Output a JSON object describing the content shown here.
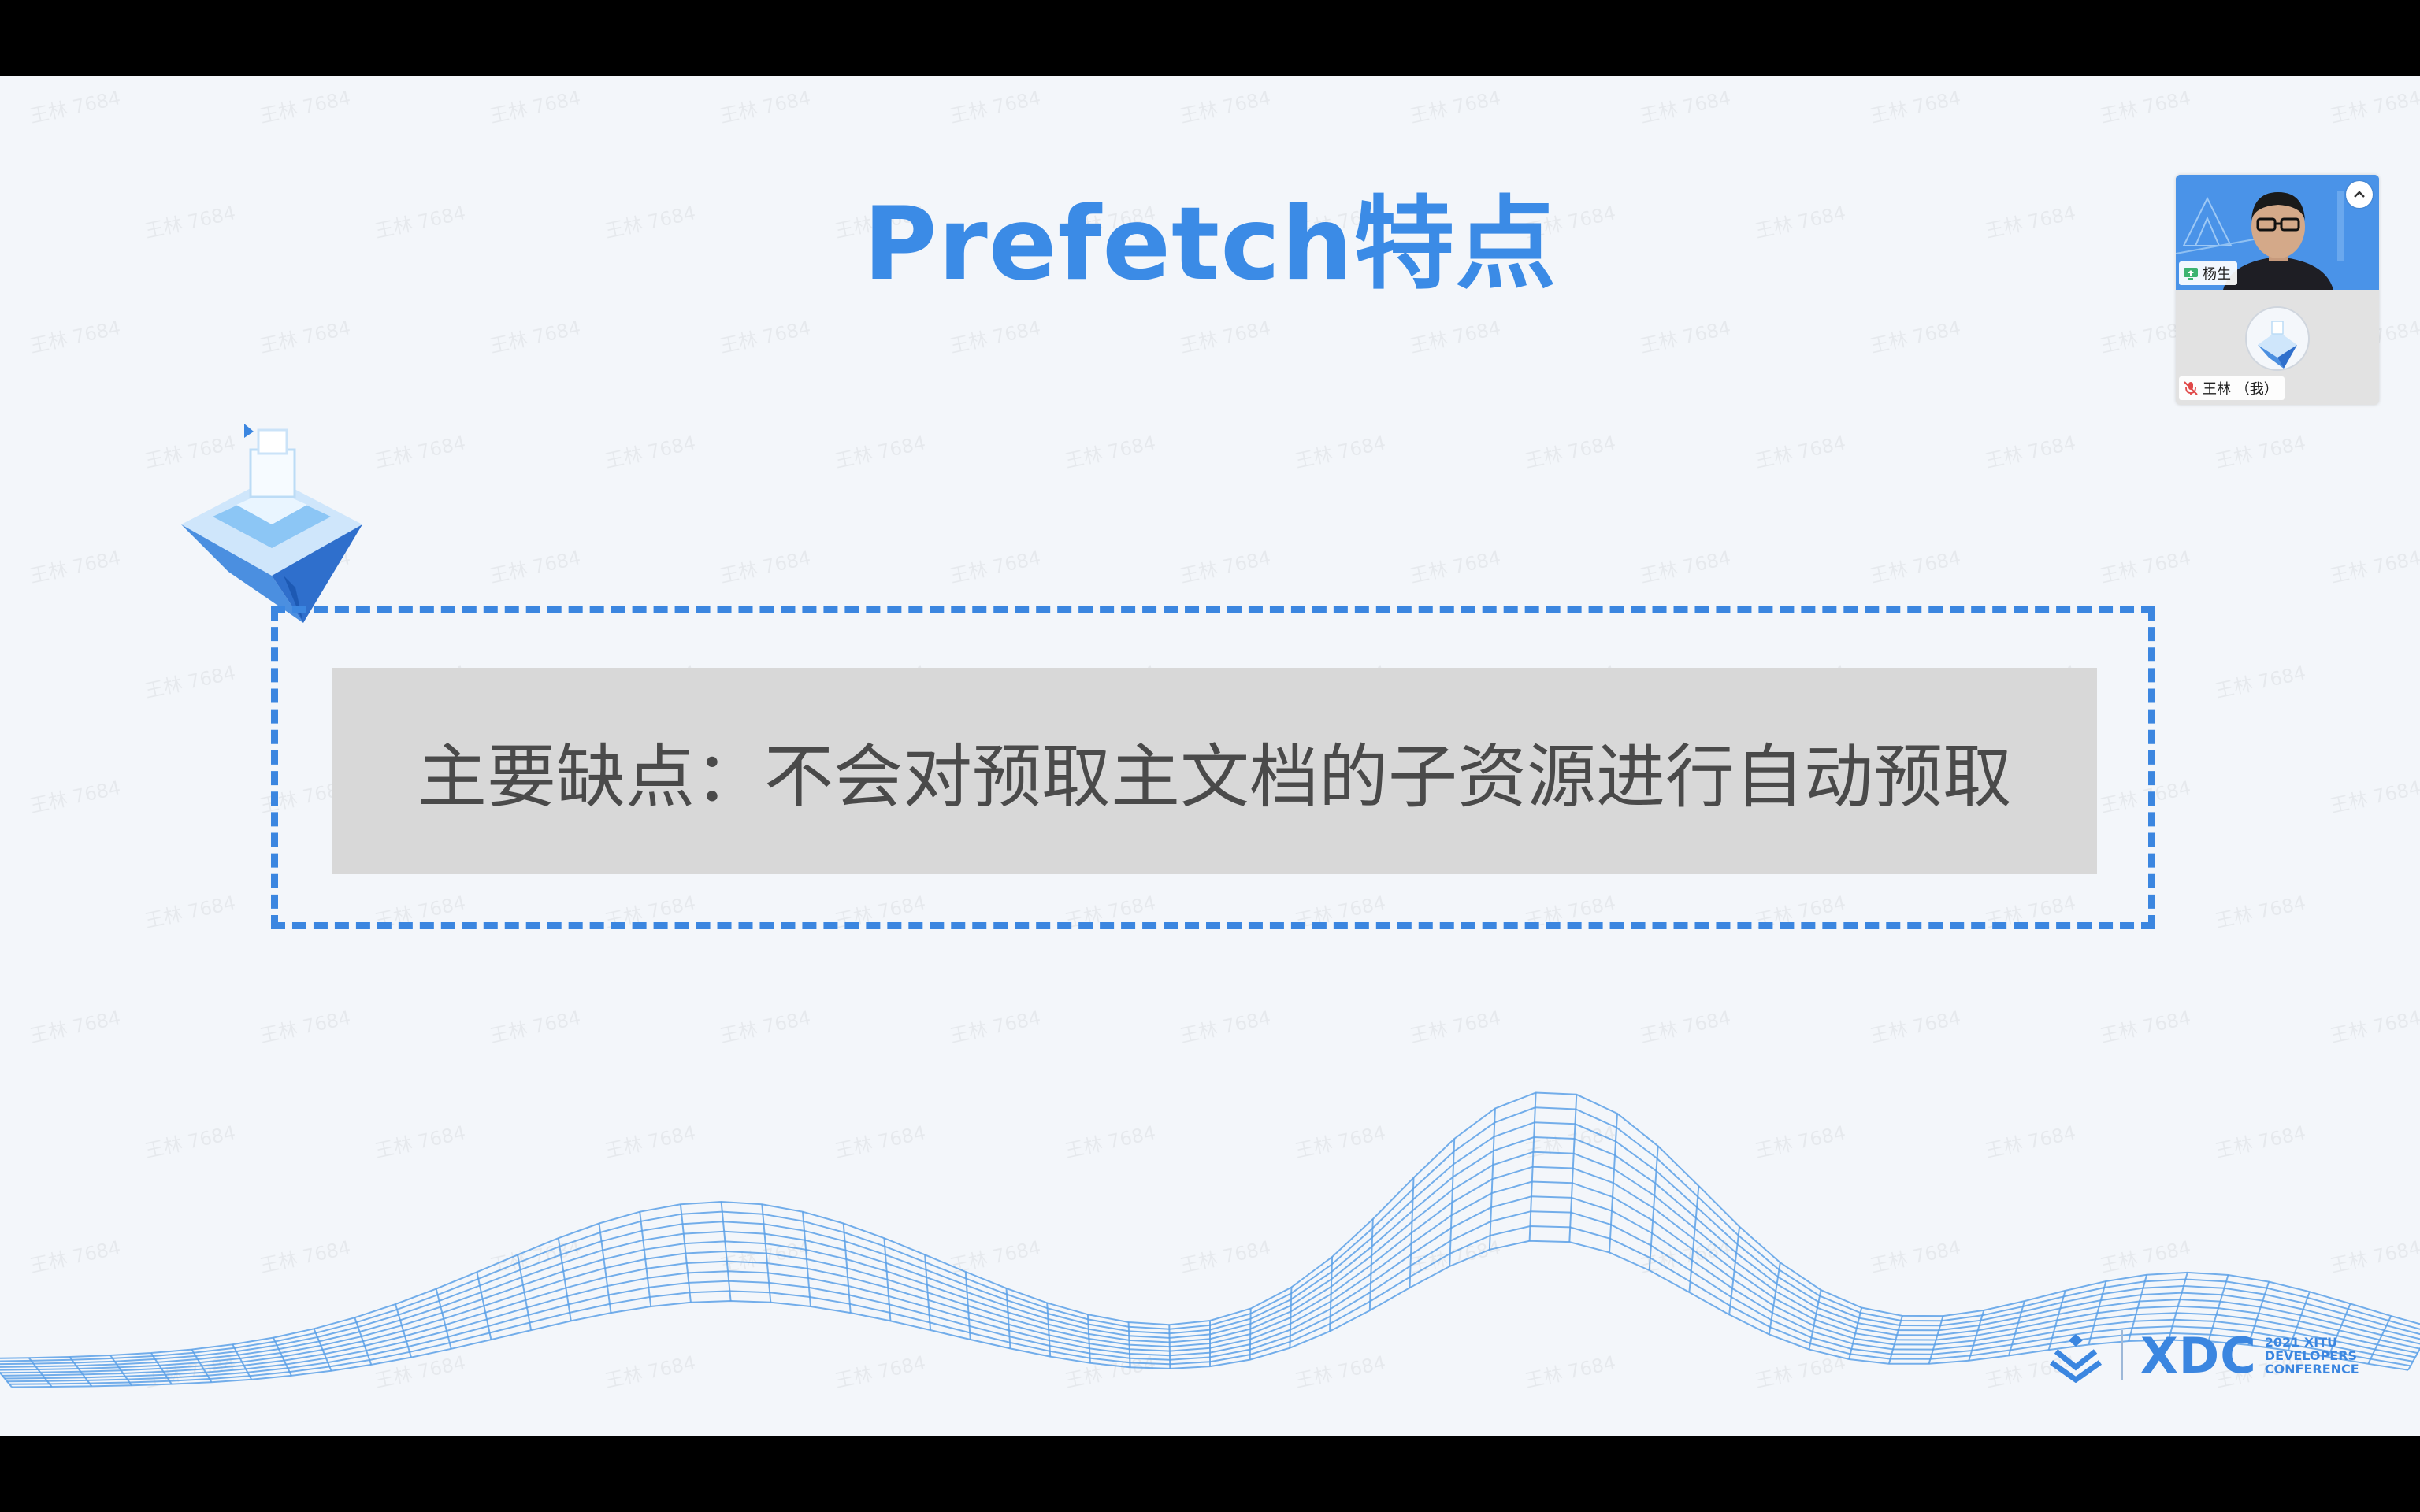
{
  "slide": {
    "title": "Prefetch特点",
    "callout": "主要缺点：不会对预取主文档的子资源进行自动预取",
    "watermark": "王林 7684",
    "brand": {
      "logo_text": "XDC",
      "sub_line_1": "2021 XITU",
      "sub_line_2": "DEVELOPERS",
      "sub_line_3": "CONFERENCE"
    }
  },
  "participants": {
    "items": [
      {
        "name": "杨生",
        "status_icon": "screen-share-icon",
        "muted": false
      },
      {
        "name": "王林 （我）",
        "status_icon": "mic-muted-icon",
        "muted": true
      }
    ],
    "collapse_icon": "chevron-up-icon"
  },
  "colors": {
    "title_blue": "#3b8be6",
    "frame_blue": "#3b86e0",
    "slide_bg": "#f3f6fa",
    "callout_bg": "#d8d8d8",
    "callout_text": "#4a4a4a",
    "mesh_blue": "#5aa0e6",
    "muted_red": "#e04848",
    "share_green": "#3cb371"
  }
}
